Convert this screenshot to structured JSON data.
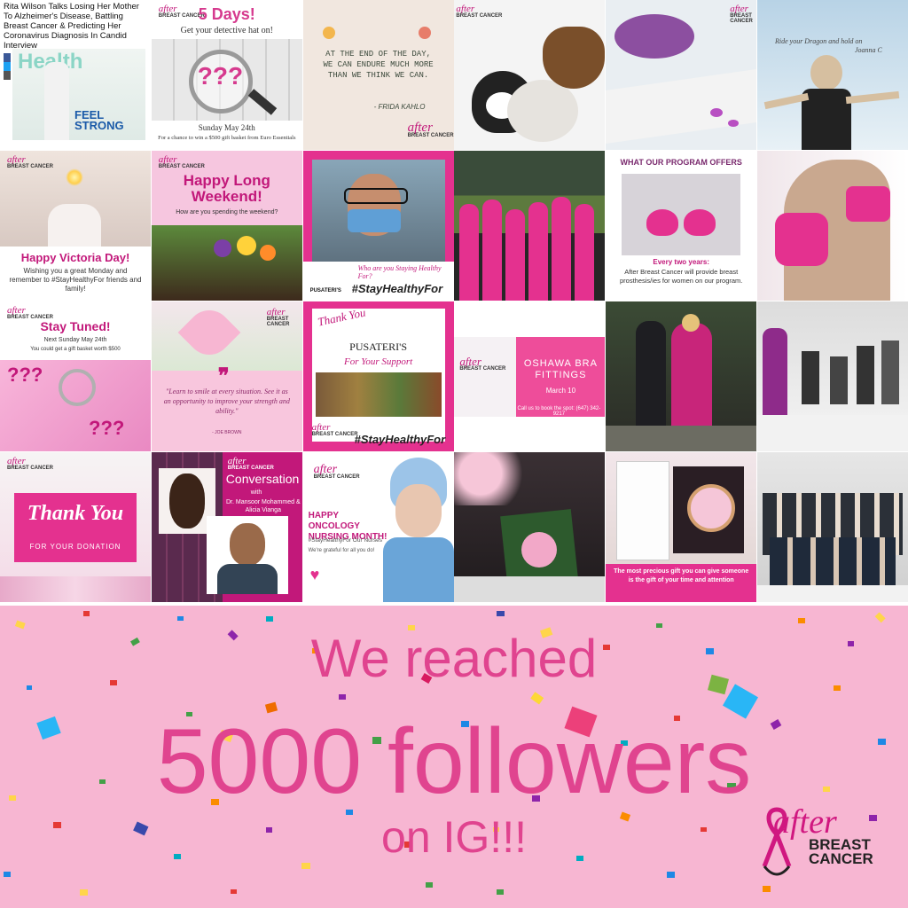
{
  "tiles": [
    {
      "title": "Rita Wilson Talks Losing Her Mother To Alzheimer's Disease, Battling Breast Cancer & Predicting Her Coronavirus Diagnosis In Candid Interview",
      "mag": "Health",
      "cover": "FEEL STRONG"
    },
    {
      "title": "5 Days!",
      "sub": "Get your detective hat on!",
      "marks": "???",
      "foot1": "Sunday May 24th",
      "foot2": "For a chance to win a $500 gift basket from Euro Essentials"
    },
    {
      "quote": "AT THE END OF THE DAY, WE CAN ENDURE MUCH MORE THAN WE THINK WE CAN.",
      "author": "- FRIDA KAHLO"
    },
    {
      "caption": "pets"
    },
    {
      "caption": "purple flowers"
    },
    {
      "caption": "Ride your Dragon and hold on",
      "name": "Joanna C"
    },
    {
      "title": "Happy Victoria Day!",
      "sub": "Wishing you a great Monday and remember to #StayHealthyFor friends and family!"
    },
    {
      "title": "Happy Long Weekend!",
      "sub": "How are you spending the weekend?"
    },
    {
      "tag": "#StayHealthyFor",
      "ask": "Who are you Staying Healthy For?",
      "brand": "PUSATERI'S"
    },
    {
      "caption": "team"
    },
    {
      "title": "WHAT OUR PROGRAM OFFERS",
      "lead": "Every two years:",
      "body": "After Breast Cancer will provide breast prosthesis/ies for women on our program."
    },
    {
      "caption": "fist"
    },
    {
      "title": "Stay Tuned!",
      "sub": "Next Sunday May 24th",
      "sub2": "You could get a gift basket worth $500",
      "marks": "???"
    },
    {
      "quote": "\"Learn to smile at every situation. See it as an opportunity to improve your strength and ability.\"",
      "author": "- JOE BROWN"
    },
    {
      "thanks": "Thank You",
      "name": "PUSATERI'S",
      "support": "For Your Support",
      "tag": "#StayHealthyFor"
    },
    {
      "title": "OSHAWA BRA FITTINGS",
      "date": "March 10",
      "call": "Call us to book the spot: (647) 342-9217"
    },
    {
      "caption": "gowns"
    },
    {
      "caption": "fitness"
    },
    {
      "title": "Thank You",
      "sub": "FOR YOUR DONATION"
    },
    {
      "title": "Conversation",
      "with": "with",
      "names": "Dr. Mansoor Mohammed & Alicia Vianga"
    },
    {
      "title": "HAPPY ONCOLOGY NURSING MONTH!",
      "tag": "#StayHealthyFor Our Nurses",
      "sub": "We're grateful for all you do!"
    },
    {
      "caption": "painting"
    },
    {
      "caption": "The most precious gift you can give someone is the gift of your time and attention"
    },
    {
      "caption": "group"
    }
  ],
  "logo": {
    "word": "after",
    "sub": "BREAST CANCER"
  },
  "banner": {
    "line1": "We reached",
    "line2": "5000 followers",
    "line3": "on IG!!!"
  },
  "brand": {
    "word": "after",
    "line1": "BREAST",
    "line2": "CANCER"
  },
  "colors": {
    "background": "#f7b6d2",
    "accent": "#e0448f",
    "brand": "#d01880"
  }
}
